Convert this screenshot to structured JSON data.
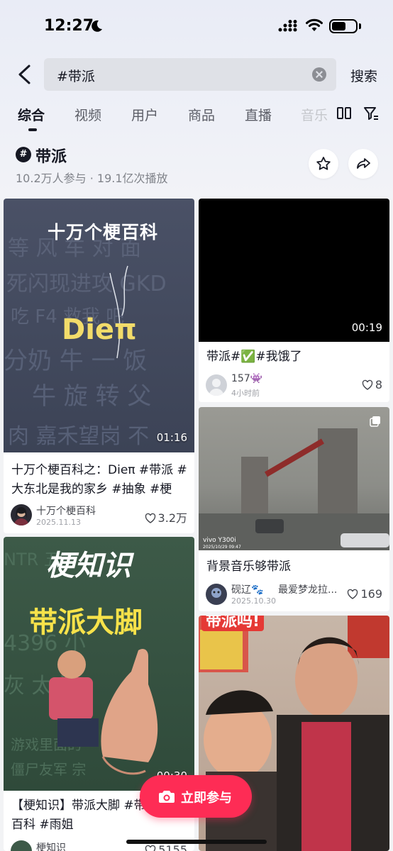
{
  "status": {
    "time": "12:27",
    "battery_level": 0.6
  },
  "search": {
    "query": "#带派",
    "button_label": "搜索"
  },
  "tabs": [
    {
      "label": "综合",
      "active": true
    },
    {
      "label": "视频"
    },
    {
      "label": "用户"
    },
    {
      "label": "商品"
    },
    {
      "label": "直播"
    },
    {
      "label": "音乐"
    }
  ],
  "topic": {
    "name": "带派",
    "icon_label": "#",
    "stats": "10.2万人参与 · 19.1亿次播放"
  },
  "cards": [
    {
      "thumb_title": "十万个梗百科",
      "thumb_big": "Dieπ",
      "duration": "01:16",
      "title": "十万个梗百科之：Dieπ #带派 #大东北是我的家乡 #抽象 #梗",
      "author": "十万个梗百科",
      "date": "2025.11.13",
      "likes": "3.2万"
    },
    {
      "duration": "00:19",
      "title": "带派#✅#我饿了",
      "author": "157👾",
      "date": "4小时前",
      "likes": "8"
    },
    {
      "watermark": "vivo Y300i",
      "watermark2": "2025/10/29 09:47",
      "title": "背景音乐够带派",
      "author": "砚辽🐾",
      "author_extra": "最爱梦龙拉...",
      "date": "2025.10.30",
      "likes": "169"
    },
    {
      "thumb_title": "梗知识",
      "thumb_big": "带派大脚",
      "duration": "00:30",
      "title": "【梗知识】带派大脚 #带派 #梗百科 #雨姐",
      "author": "梗知识",
      "likes": "5155"
    },
    {
      "thumb_banner": "带派吗!"
    }
  ],
  "join_button": {
    "label": "立即参与"
  },
  "colors": {
    "accent": "#fe2c55"
  }
}
